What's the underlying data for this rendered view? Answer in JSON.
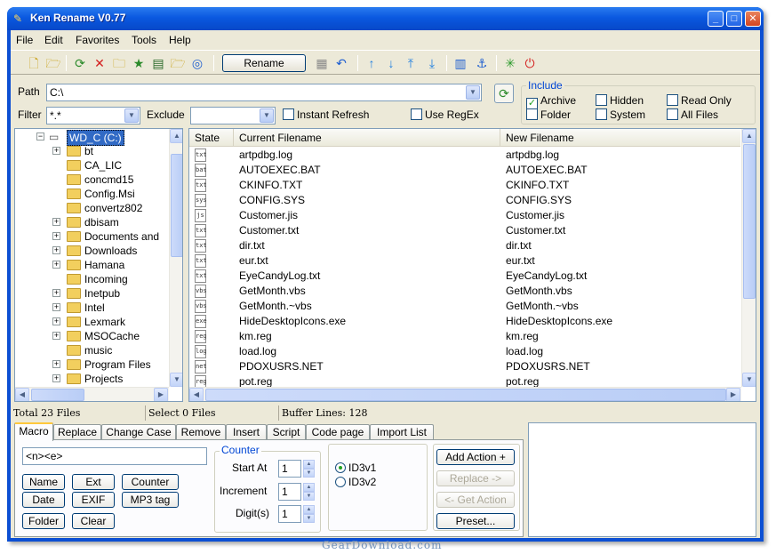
{
  "window": {
    "title": "Ken Rename V0.77"
  },
  "menu": [
    "File",
    "Edit",
    "Favorites",
    "Tools",
    "Help"
  ],
  "toolbar": {
    "rename_label": "Rename"
  },
  "path": {
    "label": "Path",
    "value": "C:\\"
  },
  "filter": {
    "label": "Filter",
    "value": "*.*",
    "exclude_label": "Exclude",
    "exclude_value": "",
    "instant_refresh": "Instant Refresh",
    "use_regex": "Use RegEx"
  },
  "include": {
    "title": "Include",
    "archive": "Archive",
    "hidden": "Hidden",
    "read_only": "Read Only",
    "folder": "Folder",
    "system": "System",
    "all_files": "All Files"
  },
  "tree": {
    "root": "WD_C (C:)",
    "items": [
      {
        "label": "bt",
        "expandable": true
      },
      {
        "label": "CA_LIC",
        "expandable": false
      },
      {
        "label": "concmd15",
        "expandable": false
      },
      {
        "label": "Config.Msi",
        "expandable": false
      },
      {
        "label": "convertz802",
        "expandable": false
      },
      {
        "label": "dbisam",
        "expandable": true
      },
      {
        "label": "Documents and",
        "expandable": true
      },
      {
        "label": "Downloads",
        "expandable": true
      },
      {
        "label": "Hamana",
        "expandable": true
      },
      {
        "label": "Incoming",
        "expandable": false
      },
      {
        "label": "Inetpub",
        "expandable": true
      },
      {
        "label": "Intel",
        "expandable": true
      },
      {
        "label": "Lexmark",
        "expandable": true
      },
      {
        "label": "MSOCache",
        "expandable": true
      },
      {
        "label": "music",
        "expandable": false
      },
      {
        "label": "Program Files",
        "expandable": true
      },
      {
        "label": "Projects",
        "expandable": true
      }
    ]
  },
  "list": {
    "columns": {
      "state": "State",
      "current": "Current Filename",
      "new": "New Filename"
    },
    "rows": [
      {
        "icon": "txt",
        "current": "artpdbg.log",
        "new": "artpdbg.log"
      },
      {
        "icon": "bat",
        "current": "AUTOEXEC.BAT",
        "new": "AUTOEXEC.BAT"
      },
      {
        "icon": "txt",
        "current": "CKINFO.TXT",
        "new": "CKINFO.TXT"
      },
      {
        "icon": "sys",
        "current": "CONFIG.SYS",
        "new": "CONFIG.SYS"
      },
      {
        "icon": "js",
        "current": "Customer.jis",
        "new": "Customer.jis"
      },
      {
        "icon": "txt",
        "current": "Customer.txt",
        "new": "Customer.txt"
      },
      {
        "icon": "txt",
        "current": "dir.txt",
        "new": "dir.txt"
      },
      {
        "icon": "txt",
        "current": "eur.txt",
        "new": "eur.txt"
      },
      {
        "icon": "txt",
        "current": "EyeCandyLog.txt",
        "new": "EyeCandyLog.txt"
      },
      {
        "icon": "vbs",
        "current": "GetMonth.vbs",
        "new": "GetMonth.vbs"
      },
      {
        "icon": "vbs",
        "current": "GetMonth.~vbs",
        "new": "GetMonth.~vbs"
      },
      {
        "icon": "exe",
        "current": "HideDesktopIcons.exe",
        "new": "HideDesktopIcons.exe"
      },
      {
        "icon": "reg",
        "current": "km.reg",
        "new": "km.reg"
      },
      {
        "icon": "log",
        "current": "load.log",
        "new": "load.log"
      },
      {
        "icon": "net",
        "current": "PDOXUSRS.NET",
        "new": "PDOXUSRS.NET"
      },
      {
        "icon": "reg",
        "current": "pot.reg",
        "new": "pot.reg"
      }
    ]
  },
  "status": {
    "total": "Total 23 Files",
    "select": "Select 0 Files",
    "buffer": "Buffer Lines: 128"
  },
  "tabs": [
    "Macro",
    "Replace",
    "Change Case",
    "Remove",
    "Insert",
    "Script",
    "Code page",
    "Import List"
  ],
  "macro": {
    "value": "<n><e>",
    "buttons": [
      "Name",
      "Ext",
      "Counter",
      "Date",
      "EXIF",
      "MP3 tag",
      "Folder",
      "Clear"
    ]
  },
  "counter": {
    "title": "Counter",
    "start_label": "Start At",
    "start_value": "1",
    "increment_label": "Increment",
    "increment_value": "1",
    "digits_label": "Digit(s)",
    "digits_value": "1"
  },
  "id3": {
    "v1": "ID3v1",
    "v2": "ID3v2"
  },
  "actions": {
    "add": "Add Action +",
    "replace": "Replace ->",
    "get": "<- Get Action",
    "preset": "Preset..."
  },
  "watermark": "GearDownload.com"
}
